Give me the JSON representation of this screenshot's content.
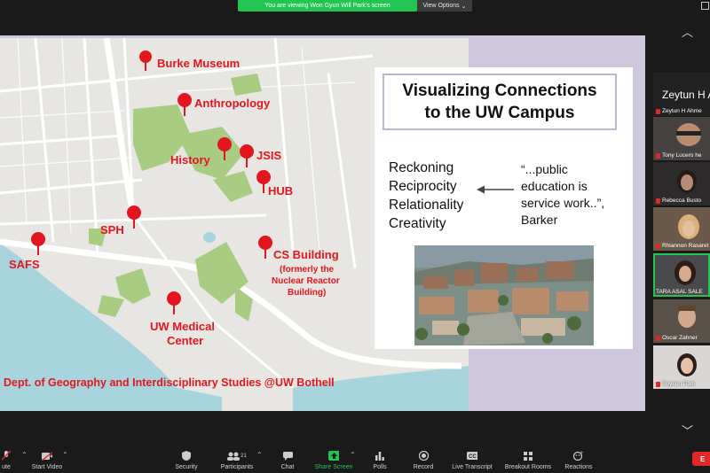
{
  "banner": {
    "text": "You are viewing Won Gyun Will Park's screen",
    "view_options": "View Options"
  },
  "map": {
    "labels": {
      "burke": "Burke Museum",
      "anthro": "Anthropology",
      "history": "History",
      "jsis": "JSIS",
      "hub": "HUB",
      "sph": "SPH",
      "safs": "SAFS",
      "cs1": "CS Building",
      "cs2": "(formerly the",
      "cs3": "Nuclear Reactor",
      "cs4": "Building)",
      "med1": "UW Medical",
      "med2": "Center",
      "credit": "Dept. of Geography and Interdisciplinary Studies @UW Bothell"
    }
  },
  "slide": {
    "title_line1": "Visualizing Connections",
    "title_line2": "to the UW Campus",
    "concepts": [
      "Reckoning",
      "Reciprocity",
      "Relationality",
      "Creativity"
    ],
    "quote": [
      "“...public",
      "education is",
      "service work..”,",
      "Barker"
    ]
  },
  "gallery": {
    "first_name": "Zeytun H A",
    "first_full": "Zeytun H Ahme",
    "participants": [
      {
        "name": "Tony Lucero he"
      },
      {
        "name": "Rebecca Busto"
      },
      {
        "name": "Rhiannon Rasaret"
      },
      {
        "name": "TARA ASAL SALE"
      },
      {
        "name": "Oscar Zahner"
      },
      {
        "name": "Soyeon Park"
      }
    ]
  },
  "toolbar": {
    "mute": "ute",
    "start_video": "Start Video",
    "security": "Security",
    "participants": "Participants",
    "participants_count": "21",
    "chat": "Chat",
    "share_screen": "Share Screen",
    "polls": "Polls",
    "record": "Record",
    "live_transcript": "Live Transcript",
    "breakout_rooms": "Breakout Rooms",
    "reactions": "Reactions",
    "end": "E"
  },
  "colors": {
    "share_green": "#23c552",
    "pin_red": "#e3161f",
    "end_red": "#e02828",
    "slide_border": "#bfb4d6",
    "water": "#a8d5dd",
    "park": "#a9cc83"
  }
}
